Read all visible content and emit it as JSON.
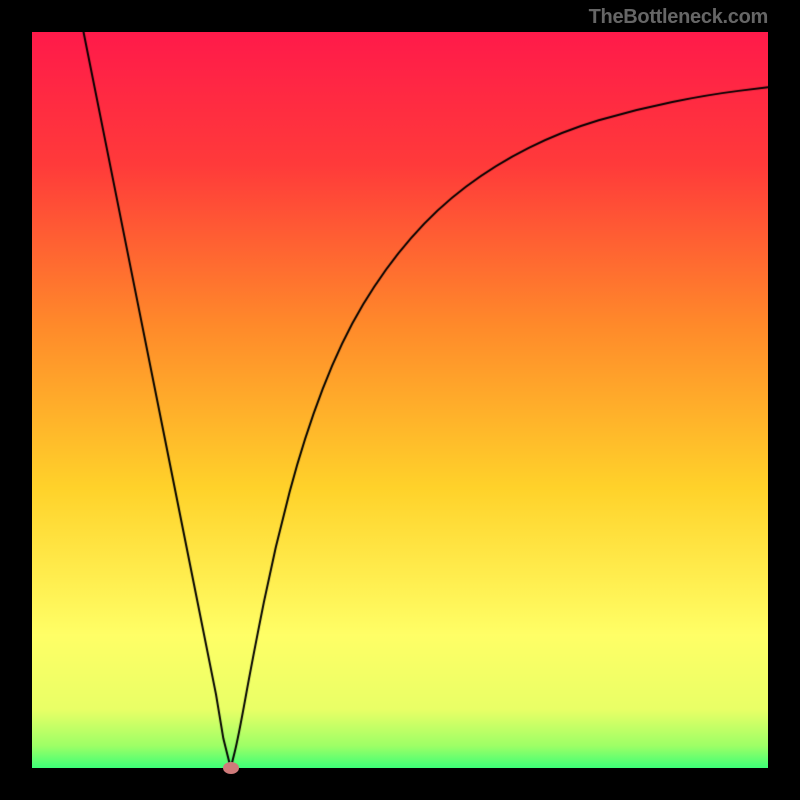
{
  "watermark": "TheBottleneck.com",
  "colors": {
    "frame": "#000000",
    "curve": "#000000",
    "marker": "#cf7a7a",
    "gradient_stops": [
      {
        "pos": 0.0,
        "color": "#ff1a4a"
      },
      {
        "pos": 0.18,
        "color": "#ff3a3a"
      },
      {
        "pos": 0.4,
        "color": "#ff8a2a"
      },
      {
        "pos": 0.62,
        "color": "#ffd22a"
      },
      {
        "pos": 0.82,
        "color": "#ffff66"
      },
      {
        "pos": 0.92,
        "color": "#e9ff66"
      },
      {
        "pos": 0.97,
        "color": "#9dff66"
      },
      {
        "pos": 1.0,
        "color": "#3dff77"
      }
    ]
  },
  "layout": {
    "image_size": 800,
    "margin": 32,
    "plot_size": 736
  },
  "chart_data": {
    "type": "line",
    "title": "",
    "xlabel": "",
    "ylabel": "",
    "x_range": [
      0,
      100
    ],
    "y_range": [
      0,
      100
    ],
    "min_point": {
      "x": 27,
      "y": 0
    },
    "series": [
      {
        "name": "bottleneck_curve",
        "points": [
          {
            "x": 7.0,
            "y": 100.0
          },
          {
            "x": 10.0,
            "y": 85.0
          },
          {
            "x": 14.0,
            "y": 65.0
          },
          {
            "x": 18.0,
            "y": 45.0
          },
          {
            "x": 22.0,
            "y": 25.0
          },
          {
            "x": 25.0,
            "y": 10.0
          },
          {
            "x": 26.0,
            "y": 4.0
          },
          {
            "x": 27.0,
            "y": 0.0
          },
          {
            "x": 28.0,
            "y": 4.0
          },
          {
            "x": 30.0,
            "y": 15.0
          },
          {
            "x": 33.0,
            "y": 30.0
          },
          {
            "x": 37.0,
            "y": 45.0
          },
          {
            "x": 42.0,
            "y": 58.0
          },
          {
            "x": 48.0,
            "y": 68.0
          },
          {
            "x": 55.0,
            "y": 76.0
          },
          {
            "x": 63.0,
            "y": 82.0
          },
          {
            "x": 72.0,
            "y": 86.5
          },
          {
            "x": 82.0,
            "y": 89.5
          },
          {
            "x": 92.0,
            "y": 91.5
          },
          {
            "x": 100.0,
            "y": 92.5
          }
        ]
      }
    ]
  }
}
